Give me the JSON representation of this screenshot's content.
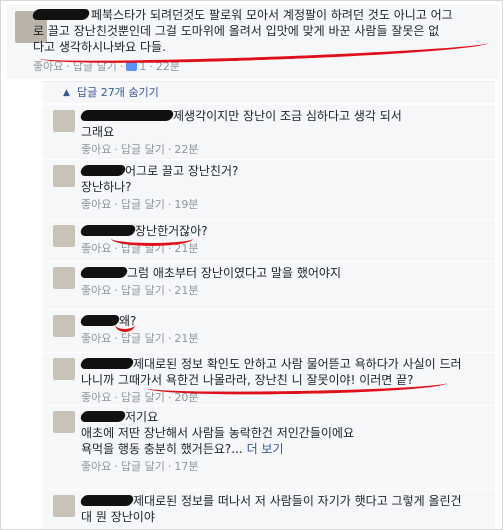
{
  "post": {
    "text_line1": "페북스타가 되려던것도 팔로워 모아서 계정팔이 하려던 것도 아니고 어그",
    "text_line2": "로 끌고 장난친것뿐인데 그걸 도마위에 올려서 입맛에 맞게 바꾼 사람들 잘못은 없",
    "text_line3": "다고 생각하시나봐요 다들.",
    "like": "좋아요",
    "reply": "답글 달기",
    "likes_count": "1",
    "time": "22분"
  },
  "toggle": {
    "label": "답글 27개 숨기기"
  },
  "replies": [
    {
      "lines": [
        "제생각이지만 장난이 조금 심하다고 생각 되서",
        "그래요"
      ],
      "like": "좋아요",
      "reply": "답글 달기",
      "time": "22분"
    },
    {
      "lines": [
        "어그로 끌고 장난친거?",
        "장난하나?"
      ],
      "like": "좋아요",
      "reply": "답글 달기",
      "time": "19분"
    },
    {
      "lines": [
        "장난한거잖아?"
      ],
      "like": "좋아요",
      "reply": "답글 달기",
      "time": "21분"
    },
    {
      "lines": [
        "그럼 애초부터 장난이였다고 말을 했어야지"
      ],
      "like": "좋아요",
      "reply": "답글 달기",
      "time": "21분"
    },
    {
      "lines": [
        "왜?"
      ],
      "like": "좋아요",
      "reply": "답글 달기",
      "time": "21분"
    },
    {
      "lines": [
        "제대로된 정보 확인도 안하고 사람 물어뜯고 욕하다가 사실이 드러",
        "나니까 그때가서 욕한건 나몰라라, 장난친 니 잘못이야! 이러면 끝?"
      ],
      "like": "좋아요",
      "reply": "답글 달기",
      "time": "20분"
    },
    {
      "lines": [
        "저기요",
        "애초에 저딴 장난해서 사람들 농락한건 저인간들이에요",
        "욕먹을 행동 충분히 했거든요?..."
      ],
      "more": "더 보기",
      "like": "좋아요",
      "reply": "답글 달기",
      "time": "17분"
    },
    {
      "lines": [
        "제대로된 정보를 떠나서 저 사람들이 자기가 햇다고 그렇게 올린건",
        "대 뭔 장난이야"
      ]
    }
  ],
  "colors": {
    "link": "#365899",
    "meta": "#90949c",
    "highlight": "#e0101a",
    "panel": "#f6f7f9"
  }
}
